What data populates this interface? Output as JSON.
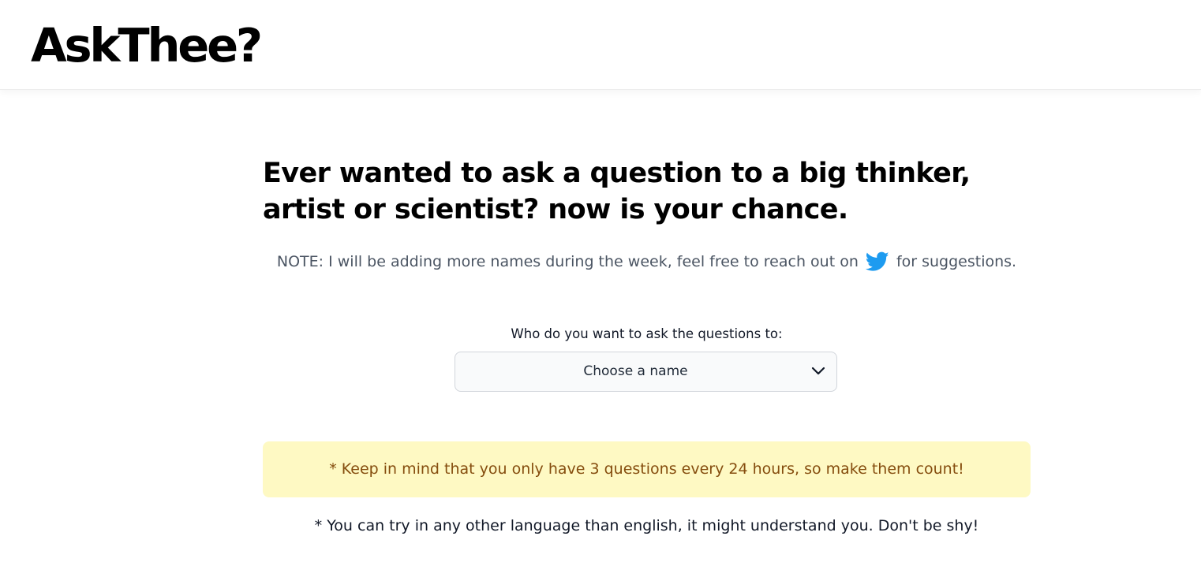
{
  "header": {
    "logo": "AskThee?"
  },
  "main": {
    "headline": "Ever wanted to ask a question to a big thinker, artist or scientist? now is your chance.",
    "note": {
      "before": "NOTE: I will be adding more names during the week, feel free to reach out on",
      "icon": "twitter-icon",
      "after": "for suggestions."
    },
    "select": {
      "label": "Who do you want to ask the questions to:",
      "value": "Choose a name",
      "icon": "chevron-down-icon"
    },
    "alert": "* Keep in mind that you only have 3 questions every 24 hours, so make them count!",
    "tip": "* You can try in any other language than english, it might understand you. Don't be shy!"
  },
  "colors": {
    "twitter": "#1d9bf0",
    "alert_bg": "#fef9c3",
    "alert_text": "#854d0e",
    "note_text": "#4b5563",
    "select_bg": "#f9fafb",
    "select_border": "#d1d5db"
  }
}
